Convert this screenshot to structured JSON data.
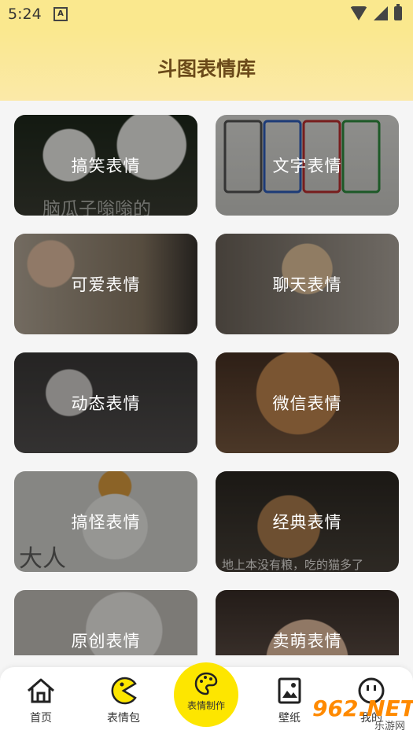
{
  "status": {
    "time": "5:24",
    "notif_icon": "A"
  },
  "header": {
    "title": "斗图表情库"
  },
  "cards": [
    {
      "label": "搞笑表情",
      "caption": "脑瓜子嗡嗡的",
      "bg": "#2f3128"
    },
    {
      "label": "文字表情",
      "caption": "",
      "bg": "#d8d8d4"
    },
    {
      "label": "可爱表情",
      "caption": "",
      "bg": "#a89a86"
    },
    {
      "label": "聊天表情",
      "caption": "",
      "bg": "#8b8378"
    },
    {
      "label": "动态表情",
      "caption": "",
      "bg": "#494747"
    },
    {
      "label": "微信表情",
      "caption": "",
      "bg": "#6b4a32"
    },
    {
      "label": "搞怪表情",
      "caption": "大人",
      "bg": "#d6d6d2"
    },
    {
      "label": "经典表情",
      "caption": "地上本没有粮，吃的猫多了",
      "bg": "#3a342c"
    },
    {
      "label": "原创表情",
      "caption": "",
      "bg": "#d0cdc8"
    },
    {
      "label": "卖萌表情",
      "caption": "",
      "bg": "#5a4c44"
    }
  ],
  "tabs": {
    "home": "首页",
    "pack": "表情包",
    "make": "表情制作",
    "wall": "壁纸",
    "me": "我的"
  },
  "watermark": {
    "main": "962.NET",
    "sub": "乐游网"
  },
  "colors": {
    "accent": "#fde600",
    "header": "#fae88e",
    "title": "#6b4a1a"
  }
}
